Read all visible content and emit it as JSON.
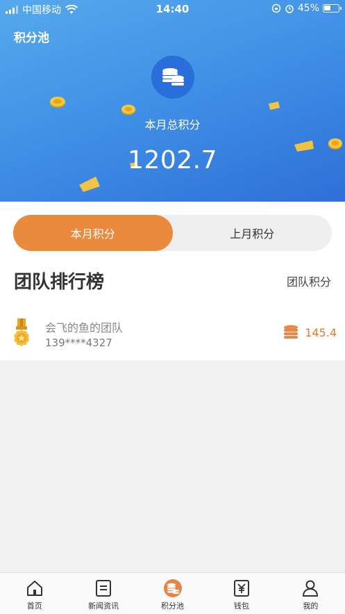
{
  "status_bar": {
    "carrier": "中国移动",
    "time": "14:40",
    "battery": "45%"
  },
  "header": {
    "title": "积分池",
    "total_label": "本月总积分",
    "total_value": "1202.7"
  },
  "toggle": {
    "options": [
      "本月积分",
      "上月积分"
    ],
    "active_index": 0
  },
  "ranking": {
    "title": "团队排行榜",
    "subtitle": "团队积分",
    "items": [
      {
        "name": "会飞的鱼的团队",
        "phone": "139****4327",
        "score": "145.4"
      }
    ]
  },
  "tabbar": {
    "items": [
      {
        "label": "首页",
        "icon": "home-icon"
      },
      {
        "label": "新闻资讯",
        "icon": "news-icon"
      },
      {
        "label": "积分池",
        "icon": "coins-icon"
      },
      {
        "label": "钱包",
        "icon": "wallet-icon"
      },
      {
        "label": "我的",
        "icon": "user-icon"
      }
    ],
    "active_index": 2
  },
  "colors": {
    "accent": "#ea8a3d",
    "hero_blue": "#3f8fe6",
    "score": "#e07b2e"
  }
}
